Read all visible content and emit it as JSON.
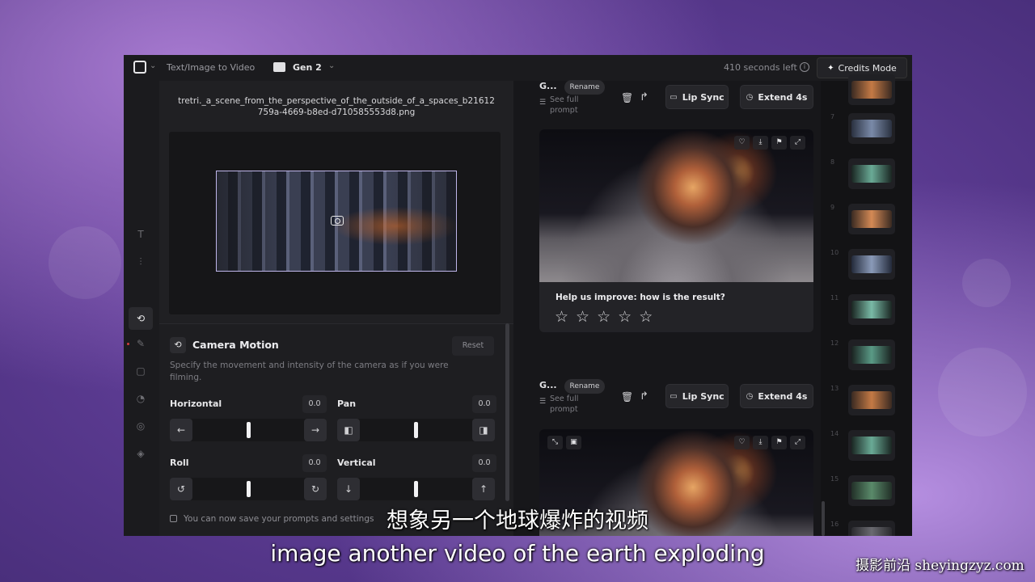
{
  "topbar": {
    "breadcrumb": "Text/Image to Video",
    "project": "Gen 2",
    "seconds_left": "410 seconds left",
    "credits_label": "Credits Mode"
  },
  "left_panel": {
    "filename_line1": "tretri._a_scene_from_the_perspective_of_the_outside_of_a_spaces_b21612",
    "filename_line2": "759a-4669-b8ed-d710585553d8.png",
    "camera_motion": {
      "title": "Camera Motion",
      "reset": "Reset",
      "description": "Specify the movement and intensity of the camera as if you were filming.",
      "controls": {
        "horizontal": {
          "label": "Horizontal",
          "value": "0.0",
          "level": 0.5
        },
        "pan": {
          "label": "Pan",
          "value": "0.0",
          "level": 0.5
        },
        "roll": {
          "label": "Roll",
          "value": "0.0",
          "level": 0.5
        },
        "vertical": {
          "label": "Vertical",
          "value": "0.0",
          "level": 0.5
        }
      }
    },
    "notice": "You can now save your prompts and settings"
  },
  "results": [
    {
      "title": "G...",
      "rename": "Rename",
      "see_full_line1": "See full",
      "see_full_line2": "prompt",
      "lip_sync": "Lip Sync",
      "extend": "Extend 4s",
      "feedback_title": "Help us improve: how is the result?",
      "stars": 5
    },
    {
      "title": "G...",
      "rename": "Rename",
      "see_full_line1": "See full",
      "see_full_line2": "prompt",
      "lip_sync": "Lip Sync",
      "extend": "Extend 4s"
    }
  ],
  "filmstrip": {
    "numbers": [
      "7",
      "8",
      "9",
      "10",
      "11",
      "12",
      "13",
      "14",
      "15",
      "16"
    ]
  },
  "subtitles": {
    "chinese": "想象另一个地球爆炸的视频",
    "english": "image another video of the earth exploding"
  },
  "watermark": "摄影前沿 sheyingzyz.com",
  "colors": {
    "app_bg": "#1b1b1e",
    "panel_bg": "#202023",
    "selection_border": "#bfb6ea"
  }
}
